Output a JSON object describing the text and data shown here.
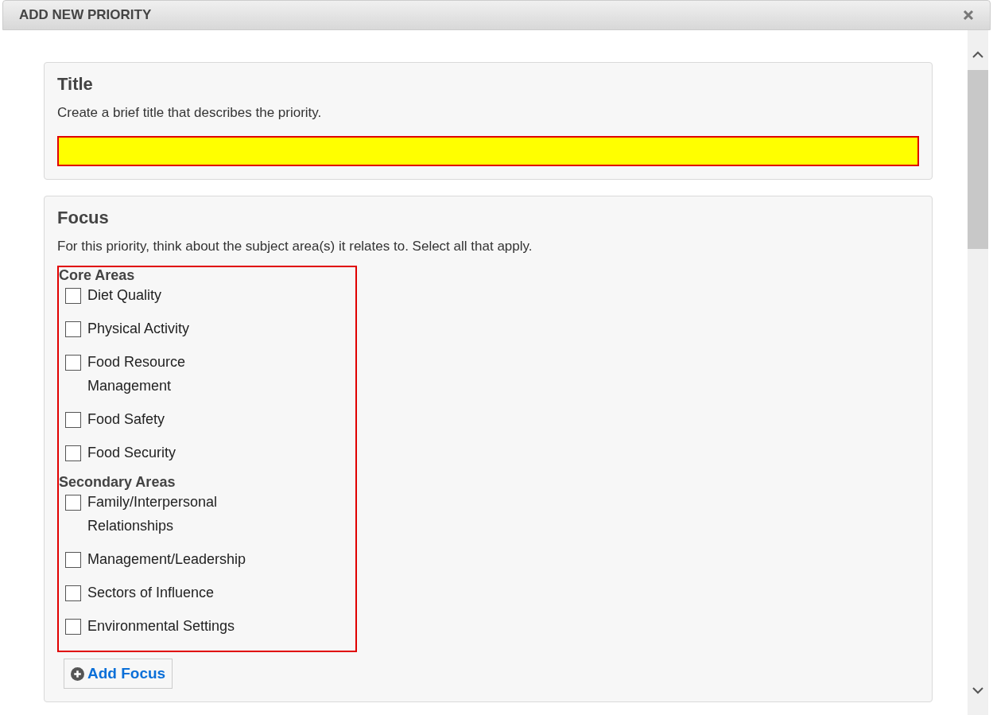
{
  "dialog": {
    "title": "ADD NEW PRIORITY"
  },
  "sections": [
    {
      "kind": "text",
      "heading": "Title",
      "description": "Create a brief title that describes the priority.",
      "field": {
        "invalid": true
      }
    },
    {
      "kind": "checklist",
      "heading": "Focus",
      "description": "For this priority, think about the subject area(s) it relates to. Select all that apply.",
      "invalid": true,
      "groups": [
        {
          "label": "Core Areas",
          "options": [
            {
              "label": "Diet Quality",
              "checked": false
            },
            {
              "label": "Physical Activity",
              "checked": false
            },
            {
              "label": "Food Resource Management",
              "checked": false
            },
            {
              "label": "Food Safety",
              "checked": false
            },
            {
              "label": "Food Security",
              "checked": false
            }
          ]
        },
        {
          "label": "Secondary Areas",
          "options": [
            {
              "label": "Family/Interpersonal Relationships",
              "checked": false
            },
            {
              "label": "Management/Leadership",
              "checked": false
            },
            {
              "label": "Sectors of Influence",
              "checked": false
            },
            {
              "label": "Environmental Settings",
              "checked": false
            }
          ]
        }
      ],
      "add_button": "Add Focus"
    }
  ]
}
